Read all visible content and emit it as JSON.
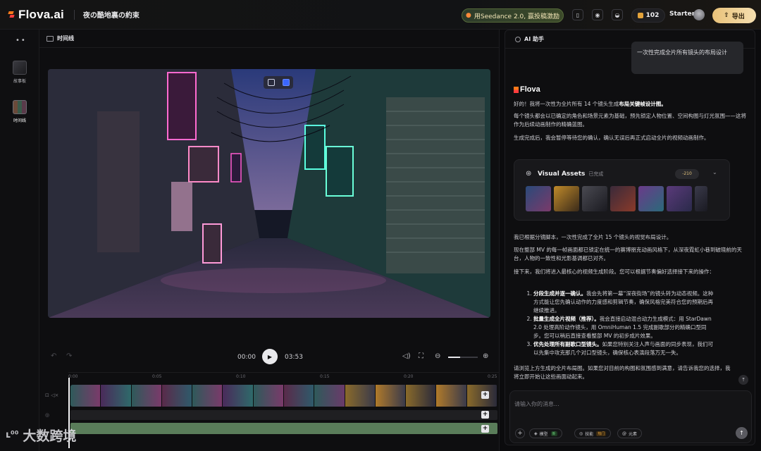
{
  "app": {
    "brand": "Flova.ai",
    "project_title": "夜の酷地裏の約束"
  },
  "topbar": {
    "promo": "用Seedance 2.0, 赢投稿激励",
    "credits": "102",
    "plan": "Starter",
    "export_label": "导出",
    "icons": [
      "book-icon",
      "wechat-icon",
      "discord-icon"
    ]
  },
  "rail": {
    "items": [
      {
        "label": "故事板"
      },
      {
        "label": "时间线"
      }
    ]
  },
  "timeline": {
    "header": "时间线",
    "current_time": "00:00",
    "duration": "03:53",
    "ruler": [
      "0:00",
      "0:05",
      "0:10",
      "0:15",
      "0:20",
      "0:25"
    ],
    "zoom_fraction": 0.4
  },
  "chat": {
    "header": "AI 助手",
    "user_message": "一次性完成全片所有镜头的布局设计",
    "brand": "Flova",
    "p1a": "好的！我将一次性为全片所有 14 个镜头生成",
    "p1b": "布局关键帧设计图。",
    "p2": "每个镜头都会以已确定的角色和场景元素为基础，预先锁定人物位置、空间构图与灯光氛围——这将作为后续动画制作的精确蓝图。",
    "p3": "生成完成后，我会暂停等待您的确认，确认无误后再正式启动全片的视频动画制作。",
    "assets": {
      "title": "Visual Assets",
      "status": "已完成",
      "cost": "-210"
    },
    "p4": "我已根据分镜脚本，一次性完成了全片 15 个镜头的视觉布局设计。",
    "p5": "现在整部 MV 的每一帧画面都已锁定在统一的赛博朋克动画风格下，从深夜霓虹小巷到破晓前的天台，人物的一致性和光影基调都已对齐。",
    "p6": "接下来，我们将进入最核心的视频生成阶段。您可以根据节奏偏好选择接下来的操作：",
    "steps": [
      {
        "bold": "分段生成并逐一确认。",
        "text": "我会先将第一幕“深夜街场”的镜头转为动态视频。这种方式能让您先确认动作的力度感和剪辑节奏，确保风格完美符合您的预期后再继续推进。"
      },
      {
        "bold": "批量生成全片视频（推荐）。",
        "text": "我会直接启动混合动力生成模式：用 StarDawn 2.0 处理高阶动作镜头，用 OmniHuman 1.5 完成副歌部分的精确口型同步。您可以稍后直接查看整部 MV 的初步成片效果。"
      },
      {
        "bold": "优先处理所有副歌口型镜头。",
        "text": "如果您特别关注人声与画面的同步表现，我们可以先集中攻克那几个对口型镜头，确保核心表演段落万无一失。"
      }
    ],
    "p7": "请浏览上方生成的全片布局图。如果您对目前的构图和氛围感到满意，请告诉我您的选择，我将立即开始让这些画面动起来。",
    "input_placeholder": "请输入你的消息...",
    "chips": [
      {
        "label": "模型",
        "tag": "新"
      },
      {
        "label": "技能",
        "tag": "热门"
      },
      {
        "label": "元素",
        "tag": ""
      }
    ]
  },
  "watermark": "大数跨境",
  "colors": {
    "accent_gold": "#e9c27a",
    "promo_green": "#3c4a2a",
    "track_green": "#5a7d5a"
  }
}
